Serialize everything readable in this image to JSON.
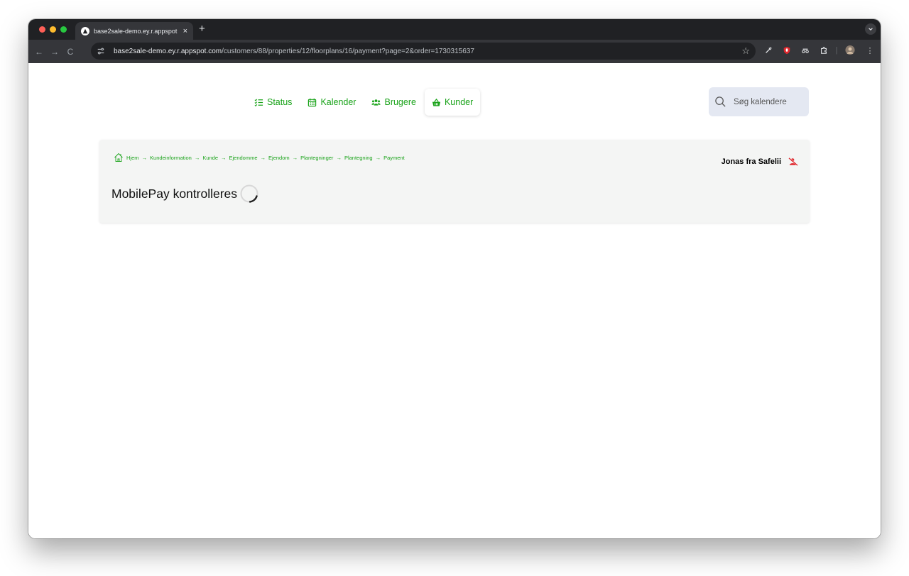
{
  "browser": {
    "tab_title": "base2sale-demo.ey.r.appspot",
    "tab_close": "×",
    "new_tab": "+",
    "url_host": "base2sale-demo.ey.r.appspot.com",
    "url_path": "/customers/88/properties/12/floorplans/16/payment?page=2&order=1730315637",
    "back": "←",
    "forward": "→",
    "reload": "C",
    "bookmark": "☆",
    "menu": "⋮"
  },
  "nav": {
    "items": [
      {
        "label": "Status",
        "icon": "list-check-icon"
      },
      {
        "label": "Kalender",
        "icon": "calendar-icon"
      },
      {
        "label": "Brugere",
        "icon": "users-icon"
      },
      {
        "label": "Kunder",
        "icon": "basket-icon",
        "active": true
      }
    ]
  },
  "search": {
    "placeholder": "Søg kalendere"
  },
  "breadcrumb": {
    "items": [
      "Hjem",
      "Kundeinformation",
      "Kunde",
      "Ejendomme",
      "Ejendom",
      "Plantegninger",
      "Plantegning",
      "Payment"
    ],
    "separator": "→"
  },
  "user": {
    "name": "Jonas fra Safelii"
  },
  "payment": {
    "status_text": "MobilePay kontrolleres"
  },
  "colors": {
    "accent": "#1aa31a",
    "alert": "#e0282e"
  }
}
